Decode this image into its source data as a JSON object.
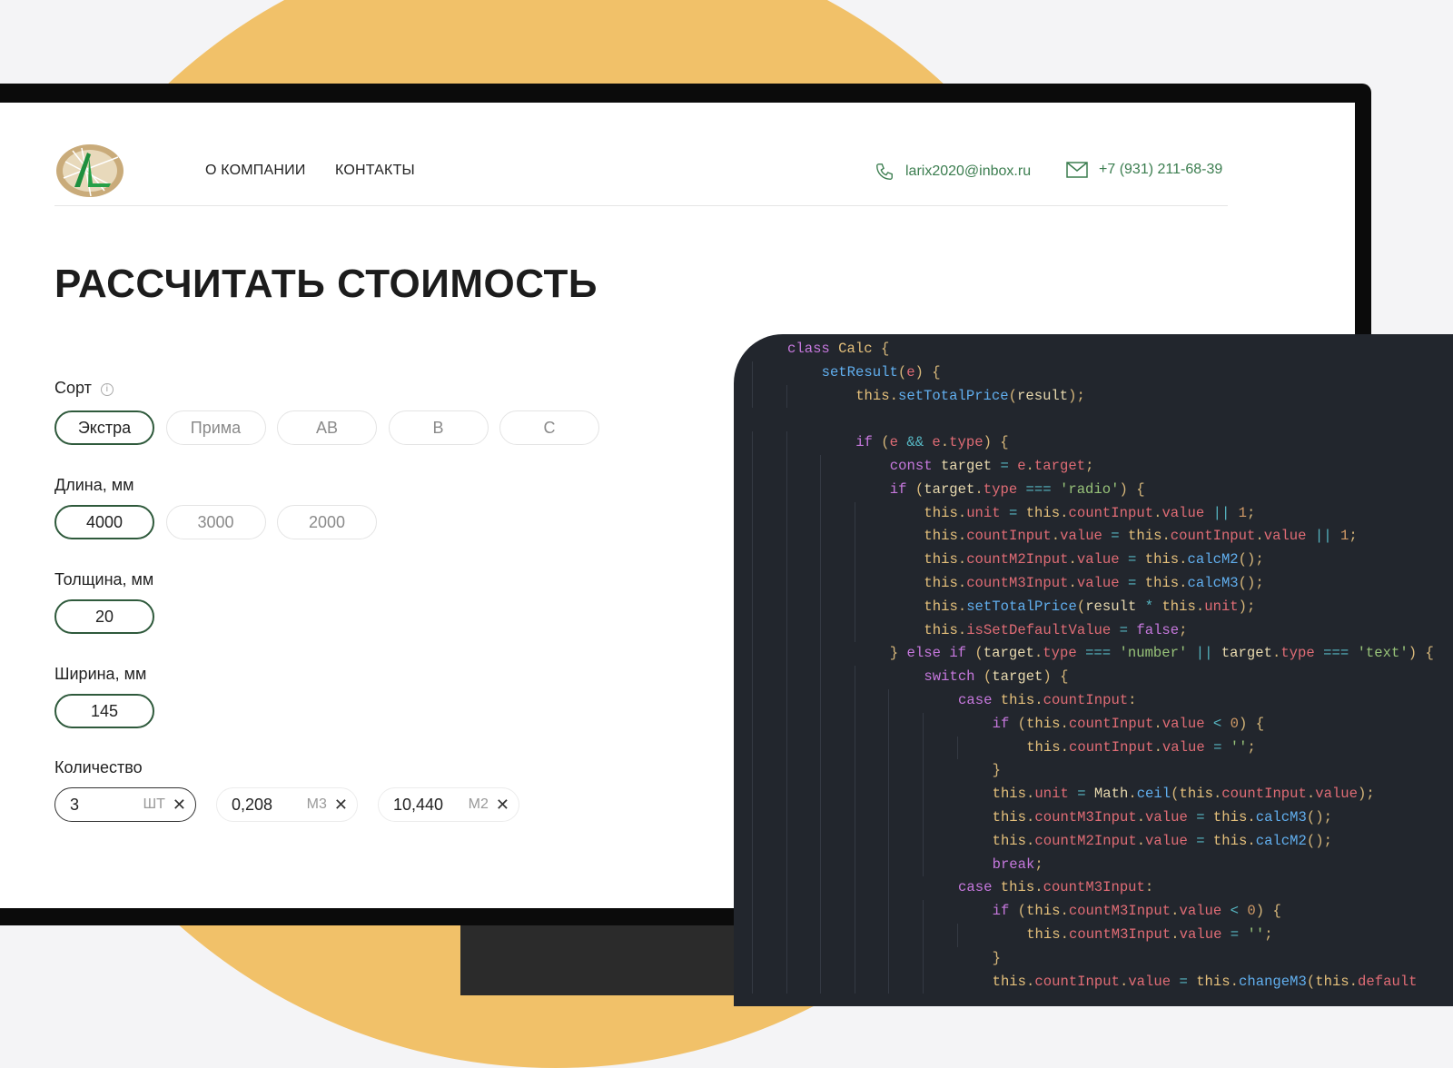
{
  "header": {
    "nav": [
      "О КОМПАНИИ",
      "КОНТАКТЫ"
    ],
    "email": "larix2020@inbox.ru",
    "phone": "+7 (931) 211-68-39",
    "logo_text": "AL"
  },
  "title": "РАССЧИТАТЬ СТОИМОСТЬ",
  "form": {
    "sort": {
      "label": "Сорт",
      "options": [
        "Экстра",
        "Прима",
        "AB",
        "B",
        "C"
      ],
      "selected": 0
    },
    "length": {
      "label": "Длина, мм",
      "options": [
        "4000",
        "3000",
        "2000"
      ],
      "selected": 0
    },
    "thickness": {
      "label": "Толщина, мм",
      "options": [
        "20"
      ],
      "selected": 0
    },
    "width": {
      "label": "Ширина, мм",
      "options": [
        "145"
      ],
      "selected": 0
    },
    "quantity": {
      "label": "Количество",
      "fields": [
        {
          "value": "3",
          "unit": "ШТ"
        },
        {
          "value": "0,208",
          "unit": "М3"
        },
        {
          "value": "10,440",
          "unit": "М2"
        }
      ]
    }
  },
  "colors": {
    "accent": "#2f5a3c",
    "link": "#3b7d4f",
    "orange": "#f1c169",
    "code_bg": "#22262d"
  },
  "code": [
    [
      0,
      "class Calc {"
    ],
    [
      1,
      "setResult(e) {"
    ],
    [
      2,
      "this.setTotalPrice(result);"
    ],
    [
      0,
      ""
    ],
    [
      2,
      "if (e && e.type) {"
    ],
    [
      3,
      "const target = e.target;"
    ],
    [
      3,
      "if (target.type === 'radio') {"
    ],
    [
      4,
      "this.unit = this.countInput.value || 1;"
    ],
    [
      4,
      "this.countInput.value = this.countInput.value || 1;"
    ],
    [
      4,
      "this.countM2Input.value = this.calcM2();"
    ],
    [
      4,
      "this.countM3Input.value = this.calcM3();"
    ],
    [
      4,
      "this.setTotalPrice(result * this.unit);"
    ],
    [
      4,
      "this.isSetDefaultValue = false;"
    ],
    [
      3,
      "} else if (target.type === 'number' || target.type === 'text') {"
    ],
    [
      4,
      "switch (target) {"
    ],
    [
      5,
      "case this.countInput:"
    ],
    [
      6,
      "if (this.countInput.value < 0) {"
    ],
    [
      7,
      "this.countInput.value = '';"
    ],
    [
      6,
      "}"
    ],
    [
      6,
      "this.unit = Math.ceil(this.countInput.value);"
    ],
    [
      6,
      "this.countM3Input.value = this.calcM3();"
    ],
    [
      6,
      "this.countM2Input.value = this.calcM2();"
    ],
    [
      6,
      "break;"
    ],
    [
      5,
      "case this.countM3Input:"
    ],
    [
      6,
      "if (this.countM3Input.value < 0) {"
    ],
    [
      7,
      "this.countM3Input.value = '';"
    ],
    [
      6,
      "}"
    ],
    [
      6,
      "this.countInput.value = this.changeM3(this.default"
    ]
  ]
}
